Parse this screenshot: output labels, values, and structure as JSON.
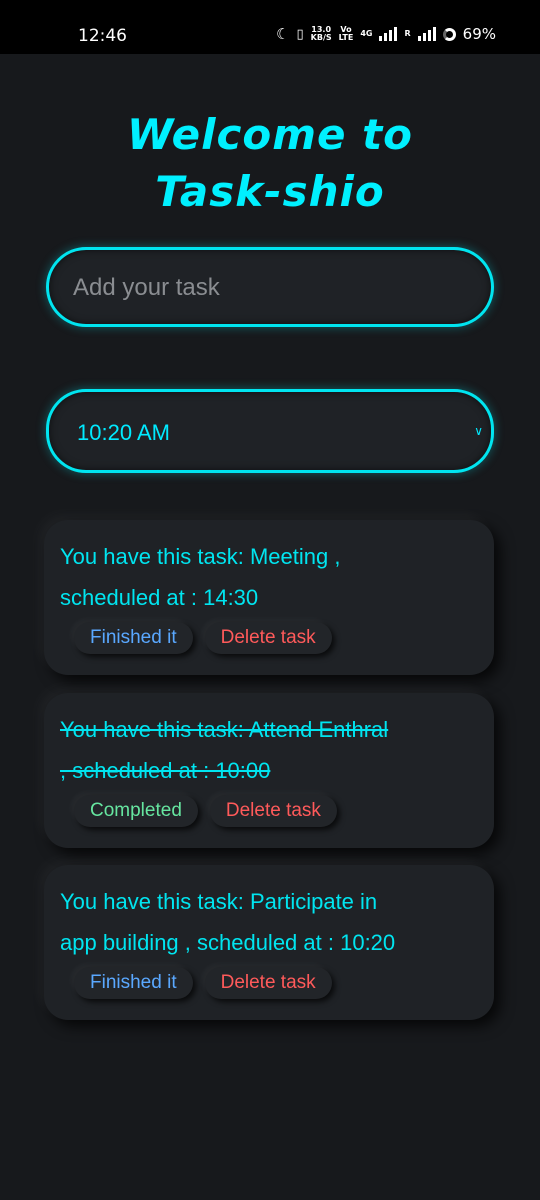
{
  "status_bar": {
    "time": "12:46",
    "net_speed_top": "13.0",
    "net_speed_bottom": "KB/S",
    "volte_top": "Vo",
    "volte_bottom": "LTE",
    "network_type": "4G",
    "carrier_r": "R",
    "battery": "69%"
  },
  "header": {
    "title_line1": "Welcome to",
    "title_line2": "Task-shio"
  },
  "task_input": {
    "placeholder": "Add your task",
    "value": ""
  },
  "time_select": {
    "value": "10:20 AM"
  },
  "tasks": [
    {
      "text_line1": "You have this task: Meeting ,",
      "text_line2": "scheduled at : 14:30",
      "status_button": "Finished it",
      "delete_button": "Delete task",
      "completed": false
    },
    {
      "text_line1": "You have this task: Attend Enthral",
      "text_line2": ", scheduled at : 10:00",
      "status_button": "Completed",
      "delete_button": "Delete task",
      "completed": true
    },
    {
      "text_line1": "You have this task: Participate in",
      "text_line2": "app building , scheduled at : 10:20",
      "status_button": "Finished it",
      "delete_button": "Delete task",
      "completed": false
    }
  ],
  "colors": {
    "accent": "#00f0ff",
    "background": "#17191c",
    "card": "#1f2226",
    "finish": "#5aa8ff",
    "completed": "#66e6a0",
    "delete": "#ff5a5a"
  }
}
